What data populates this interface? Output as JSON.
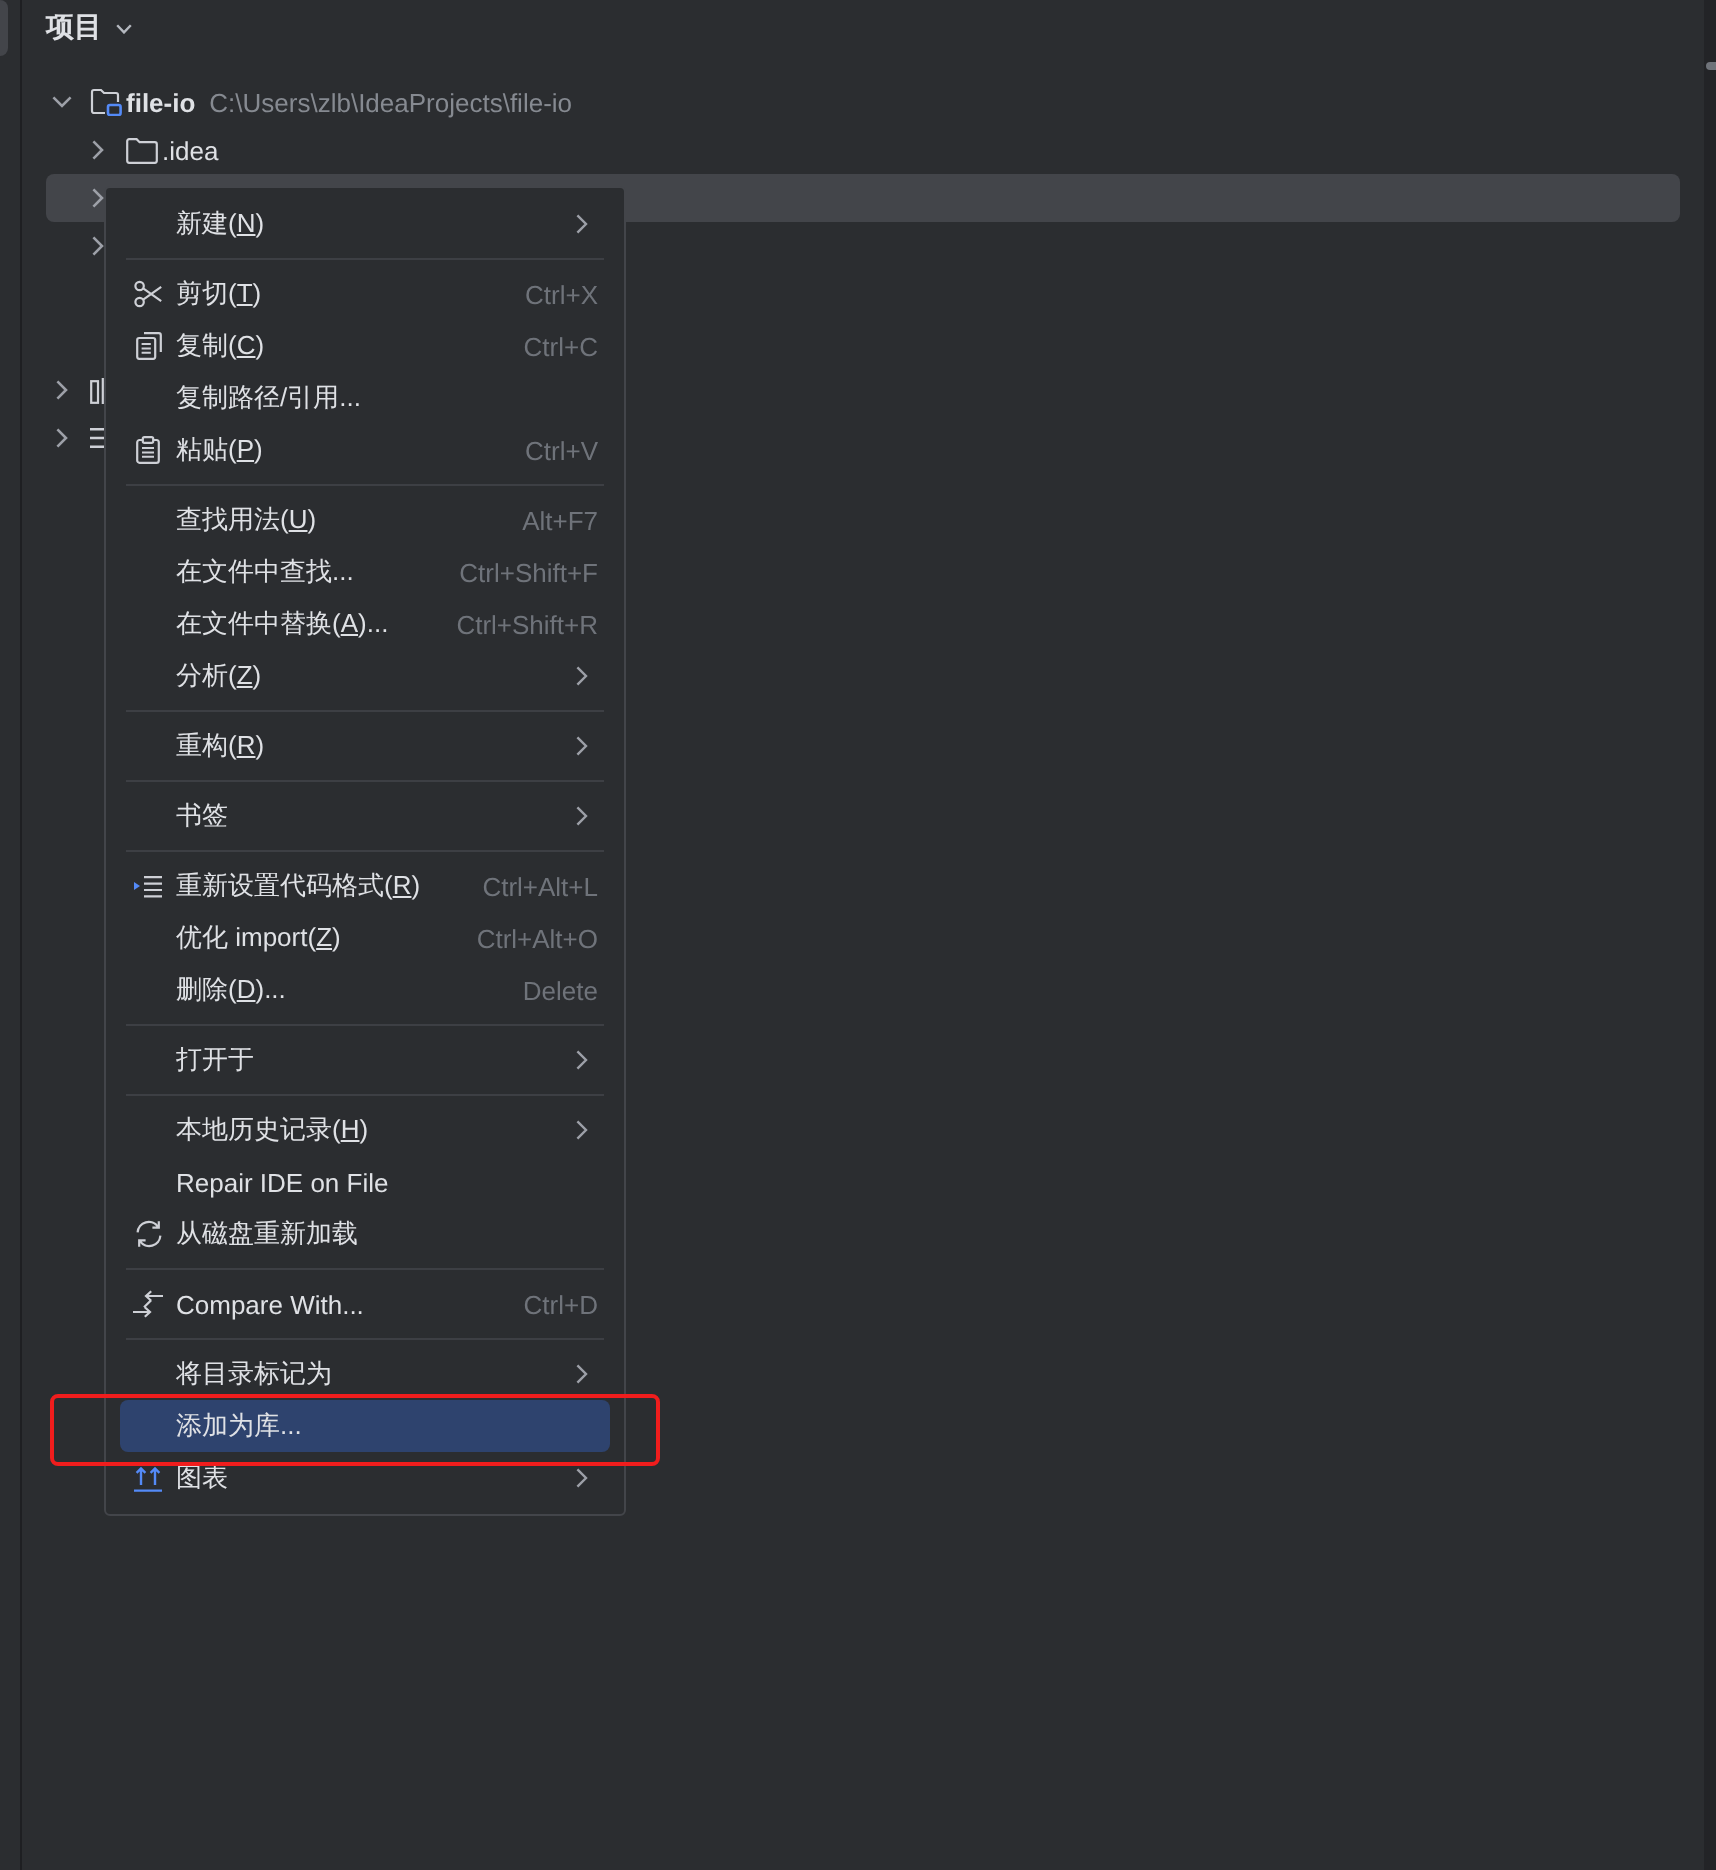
{
  "panel": {
    "title": "项目"
  },
  "tree": [
    {
      "label": "file-io",
      "path": "C:\\Users\\zlb\\IdeaProjects\\file-io",
      "expanded": true,
      "selected": false,
      "children": [
        {
          "label": ".idea",
          "expanded": false,
          "selected": false
        },
        {
          "expanded": false,
          "selected": true
        },
        {
          "expanded": false,
          "selected": false
        }
      ]
    },
    {
      "expanded": false,
      "selected": false
    },
    {
      "expanded": false,
      "selected": false
    }
  ],
  "context_menu": {
    "items": [
      {
        "kind": "item",
        "label": "新建(N)",
        "submenu": true,
        "selected": false
      },
      {
        "kind": "separator"
      },
      {
        "kind": "item",
        "label": "剪切(T)",
        "shortcut": "Ctrl+X",
        "submenu": false,
        "selected": false
      },
      {
        "kind": "item",
        "label": "复制(C)",
        "shortcut": "Ctrl+C",
        "submenu": false,
        "selected": false
      },
      {
        "kind": "item",
        "label": "复制路径/引用...",
        "submenu": false,
        "selected": false
      },
      {
        "kind": "item",
        "label": "粘贴(P)",
        "shortcut": "Ctrl+V",
        "submenu": false,
        "selected": false
      },
      {
        "kind": "separator"
      },
      {
        "kind": "item",
        "label": "查找用法(U)",
        "shortcut": "Alt+F7",
        "submenu": false,
        "selected": false
      },
      {
        "kind": "item",
        "label": "在文件中查找...",
        "shortcut": "Ctrl+Shift+F",
        "submenu": false,
        "selected": false
      },
      {
        "kind": "item",
        "label": "在文件中替换(A)...",
        "shortcut": "Ctrl+Shift+R",
        "submenu": false,
        "selected": false
      },
      {
        "kind": "item",
        "label": "分析(Z)",
        "submenu": true,
        "selected": false
      },
      {
        "kind": "separator"
      },
      {
        "kind": "item",
        "label": "重构(R)",
        "submenu": true,
        "selected": false
      },
      {
        "kind": "separator"
      },
      {
        "kind": "item",
        "label": "书签",
        "submenu": true,
        "selected": false
      },
      {
        "kind": "separator"
      },
      {
        "kind": "item",
        "label": "重新设置代码格式(R)",
        "shortcut": "Ctrl+Alt+L",
        "submenu": false,
        "selected": false
      },
      {
        "kind": "item",
        "label": "优化 import(Z)",
        "shortcut": "Ctrl+Alt+O",
        "submenu": false,
        "selected": false
      },
      {
        "kind": "item",
        "label": "删除(D)...",
        "shortcut": "Delete",
        "submenu": false,
        "selected": false
      },
      {
        "kind": "separator"
      },
      {
        "kind": "item",
        "label": "打开于",
        "submenu": true,
        "selected": false
      },
      {
        "kind": "separator"
      },
      {
        "kind": "item",
        "label": "本地历史记录(H)",
        "submenu": true,
        "selected": false
      },
      {
        "kind": "item",
        "label": "Repair IDE on File",
        "submenu": false,
        "selected": false
      },
      {
        "kind": "item",
        "label": "从磁盘重新加载",
        "submenu": false,
        "selected": false
      },
      {
        "kind": "separator"
      },
      {
        "kind": "item",
        "label": "Compare With...",
        "shortcut": "Ctrl+D",
        "submenu": false,
        "selected": false
      },
      {
        "kind": "separator"
      },
      {
        "kind": "item",
        "label": "将目录标记为",
        "submenu": true,
        "selected": false
      },
      {
        "kind": "item",
        "label": "添加为库...",
        "submenu": false,
        "selected": true
      },
      {
        "kind": "item",
        "label": "图表",
        "submenu": true,
        "selected": false
      }
    ]
  }
}
